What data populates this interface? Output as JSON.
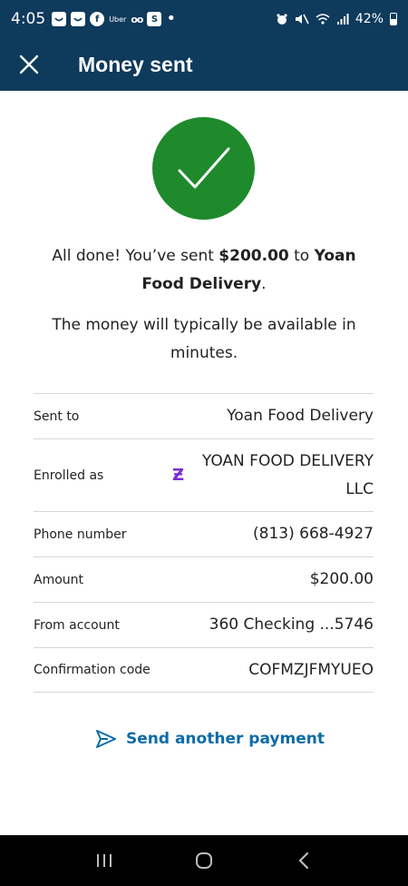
{
  "status_bar": {
    "time": "4:05",
    "app_label": "Uber",
    "battery": "42%",
    "icons": [
      "notification-icon",
      "notification-icon",
      "facebook-icon",
      "voicemail-icon",
      "s-icon",
      "alarm-icon",
      "mute-icon",
      "wifi-icon",
      "signal-icon",
      "battery-icon"
    ]
  },
  "header": {
    "title": "Money sent",
    "close_icon": "close-icon"
  },
  "confirmation": {
    "icon": "checkmark-icon",
    "color": "#1e8a2c",
    "line1_prefix": "All done! You’ve sent ",
    "amount": "$200.00",
    "line1_mid": " to ",
    "recipient": "Yoan Food Delivery",
    "line1_suffix": ".",
    "availability": "The money will typically be available in minutes."
  },
  "details": {
    "sent_to_label": "Sent to",
    "sent_to_value": "Yoan Food Delivery",
    "enrolled_label": "Enrolled as",
    "enrolled_icon": "zelle-icon",
    "enrolled_value": "YOAN FOOD DELIVERY LLC",
    "phone_label": "Phone number",
    "phone_value": "(813) 668-4927",
    "amount_label": "Amount",
    "amount_value": "$200.00",
    "from_label": "From account",
    "from_value": "360 Checking ...5746",
    "confirmation_label": "Confirmation code",
    "confirmation_value": "COFMZJFMYUEO"
  },
  "actions": {
    "send_another_label": "Send another payment",
    "send_icon": "send-icon"
  },
  "nav_bar": {
    "buttons": [
      "recent-apps-icon",
      "home-icon",
      "back-icon"
    ]
  },
  "colors": {
    "header_bg": "#0e3a5c",
    "accent_link": "#0d6ba6",
    "zelle_purple": "#7b2bd1"
  }
}
